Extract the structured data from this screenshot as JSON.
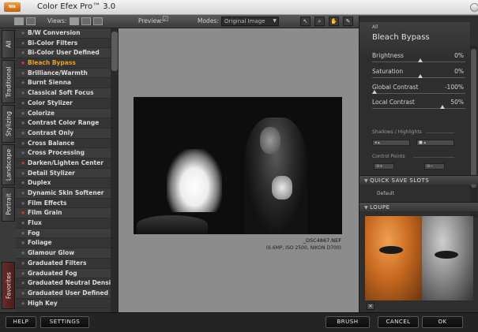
{
  "window": {
    "title": "Color Efex Pro™ 3.0",
    "logo_text": "Nik"
  },
  "toolbar": {
    "views_label": "Views:",
    "preview_label": "Preview:",
    "preview_check": "☑",
    "modes_label": "Modes:",
    "mode_value": "Original Image"
  },
  "tabs": [
    "All",
    "Traditional",
    "Stylizing",
    "Landscape",
    "Portrait",
    "Favorites"
  ],
  "filters": [
    {
      "name": "B/W Conversion",
      "fav": false
    },
    {
      "name": "Bi-Color Filters",
      "fav": false
    },
    {
      "name": "Bi-Color User Defined",
      "fav": false
    },
    {
      "name": "Bleach Bypass",
      "fav": true,
      "active": true
    },
    {
      "name": "Brilliance/Warmth",
      "fav": false
    },
    {
      "name": "Burnt Sienna",
      "fav": false
    },
    {
      "name": "Classical Soft Focus",
      "fav": false
    },
    {
      "name": "Color Stylizer",
      "fav": false
    },
    {
      "name": "Colorize",
      "fav": false
    },
    {
      "name": "Contrast Color Range",
      "fav": false
    },
    {
      "name": "Contrast Only",
      "fav": false
    },
    {
      "name": "Cross Balance",
      "fav": false
    },
    {
      "name": "Cross Processing",
      "fav": false
    },
    {
      "name": "Darken/Lighten Center",
      "fav": true
    },
    {
      "name": "Detail Stylizer",
      "fav": false
    },
    {
      "name": "Duplex",
      "fav": false
    },
    {
      "name": "Dynamic Skin Softener",
      "fav": false
    },
    {
      "name": "Film Effects",
      "fav": false
    },
    {
      "name": "Film Grain",
      "fav": true
    },
    {
      "name": "Flux",
      "fav": false
    },
    {
      "name": "Fog",
      "fav": false
    },
    {
      "name": "Foliage",
      "fav": false
    },
    {
      "name": "Glamour Glow",
      "fav": false
    },
    {
      "name": "Graduated Filters",
      "fav": false
    },
    {
      "name": "Graduated Fog",
      "fav": false
    },
    {
      "name": "Graduated Neutral Density",
      "fav": false
    },
    {
      "name": "Graduated User Defined",
      "fav": false
    },
    {
      "name": "High Key",
      "fav": false
    }
  ],
  "image": {
    "filename": "_DSC4867.NEF",
    "info": "(6.6MP, ISO 2500, NIKON D700)"
  },
  "panel": {
    "category": "All",
    "filter_name": "Bleach Bypass",
    "sliders": [
      {
        "label": "Brightness",
        "value": "0%",
        "level": 0.5
      },
      {
        "label": "Saturation",
        "value": "0%",
        "level": 0.5
      },
      {
        "label": "Global Contrast",
        "value": "-100%",
        "level": 0.0
      },
      {
        "label": "Local Contrast",
        "value": "50%",
        "level": 0.75
      }
    ],
    "shadows_label": "Shadows / Highlights",
    "control_points_label": "Control Points",
    "quick_save_label": "QUICK SAVE SLOTS",
    "default_label": "Default",
    "loupe_label": "LOUPE"
  },
  "buttons": {
    "help": "HELP",
    "settings": "SETTINGS",
    "brush": "BRUSH",
    "cancel": "CANCEL",
    "ok": "OK"
  }
}
